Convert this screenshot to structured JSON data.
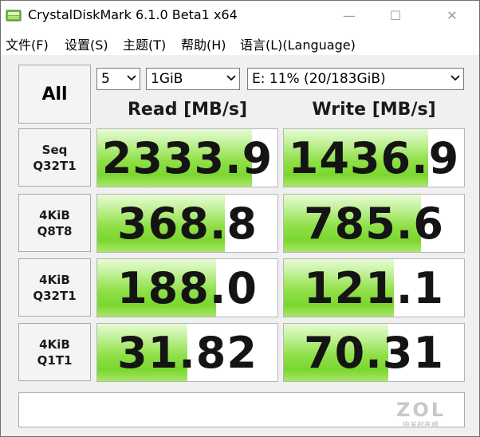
{
  "window": {
    "title": "CrystalDiskMark 6.1.0 Beta1 x64",
    "controls": {
      "minimize": "—",
      "maximize": "☐",
      "close": "✕"
    }
  },
  "menu": [
    {
      "label": "文件(F)"
    },
    {
      "label": "设置(S)"
    },
    {
      "label": "主题(T)"
    },
    {
      "label": "帮助(H)"
    },
    {
      "label": "语言(L)(Language)"
    }
  ],
  "controls": {
    "all_button": "All",
    "test_count": "5",
    "test_size": "1GiB",
    "drive": "E: 11% (20/183GiB)"
  },
  "headers": {
    "read": "Read [MB/s]",
    "write": "Write [MB/s]"
  },
  "rows": [
    {
      "line1": "Seq",
      "line2": "Q32T1",
      "read": "2333.9",
      "write": "1436.9",
      "read_fill": 0.86,
      "write_fill": 0.8
    },
    {
      "line1": "4KiB",
      "line2": "Q8T8",
      "read": "368.8",
      "write": "785.6",
      "read_fill": 0.71,
      "write_fill": 0.76
    },
    {
      "line1": "4KiB",
      "line2": "Q32T1",
      "read": "188.0",
      "write": "121.1",
      "read_fill": 0.66,
      "write_fill": 0.61
    },
    {
      "line1": "4KiB",
      "line2": "Q1T1",
      "read": "31.82",
      "write": "70.31",
      "read_fill": 0.5,
      "write_fill": 0.58
    }
  ],
  "comment": "",
  "watermark": {
    "logo": "ZOL",
    "tagline": "中关村在线"
  },
  "colors": {
    "bar_green": "#7cd62f",
    "bar_light": "#e6fbd6"
  }
}
